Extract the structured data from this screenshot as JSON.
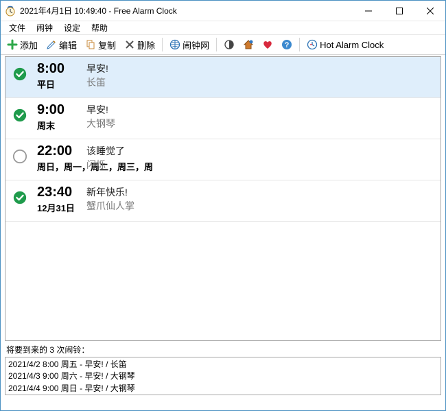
{
  "window": {
    "title": "2021年4月1日 10:49:40 - Free Alarm Clock"
  },
  "menubar": {
    "items": [
      "文件",
      "闹钟",
      "设定",
      "帮助"
    ]
  },
  "toolbar": {
    "add": "添加",
    "edit": "编辑",
    "copy": "复制",
    "delete": "删除",
    "website": "闹钟网",
    "hot": "Hot Alarm Clock"
  },
  "alarms": [
    {
      "enabled": true,
      "time": "8:00",
      "days": "平日",
      "message": "早安!",
      "sound": "长笛"
    },
    {
      "enabled": true,
      "time": "9:00",
      "days": "周末",
      "message": "早安!",
      "sound": "大钢琴"
    },
    {
      "enabled": false,
      "time": "22:00",
      "days": "周日，周一，周二，周三，周",
      "message": "该睡觉了",
      "sound": "闪烁"
    },
    {
      "enabled": true,
      "time": "23:40",
      "days": "12月31日",
      "message": "新年快乐!",
      "sound": "蟹爪仙人掌"
    }
  ],
  "upcoming": {
    "label": "将要到来的 3 次闹铃：",
    "items": [
      "2021/4/2 8:00 周五 - 早安! / 长笛",
      "2021/4/3 9:00 周六 - 早安! / 大钢琴",
      "2021/4/4 9:00 周日 - 早安! / 大钢琴"
    ]
  }
}
